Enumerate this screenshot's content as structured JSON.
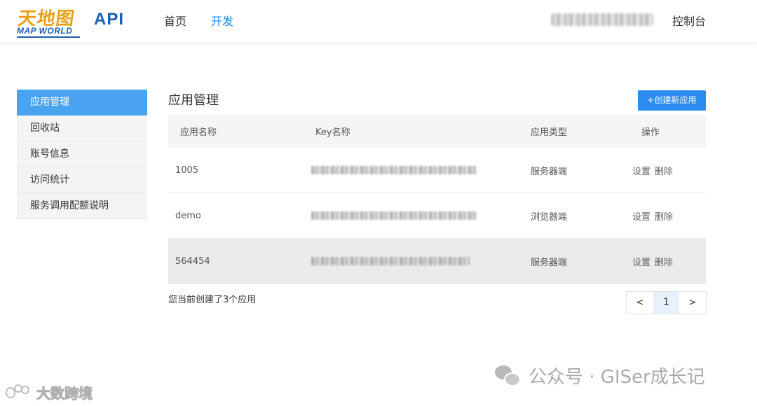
{
  "header": {
    "logo_cn": "天地图",
    "logo_en": "MAP WORLD",
    "api_label": "API",
    "nav": [
      {
        "label": "首页"
      },
      {
        "label": "开发"
      }
    ],
    "console_label": "控制台"
  },
  "sidebar": {
    "items": [
      {
        "label": "应用管理"
      },
      {
        "label": "回收站"
      },
      {
        "label": "账号信息"
      },
      {
        "label": "访问统计"
      },
      {
        "label": "服务调用配额说明"
      }
    ]
  },
  "main": {
    "title": "应用管理",
    "create_button": "+创建新应用",
    "table": {
      "headers": [
        "应用名称",
        "Key名称",
        "应用类型",
        "操作"
      ],
      "rows": [
        {
          "name": "1005",
          "type": "服务器端",
          "actions": [
            "设置",
            "删除"
          ]
        },
        {
          "name": "demo",
          "type": "浏览器端",
          "actions": [
            "设置",
            "删除"
          ]
        },
        {
          "name": "564454",
          "type": "服务器端",
          "actions": [
            "设置",
            "删除"
          ]
        }
      ]
    },
    "count_text": "您当前创建了3个应用",
    "pagination": {
      "prev": "<",
      "current": "1",
      "next": ">"
    }
  },
  "watermarks": {
    "right": "公众号 · GISer成长记",
    "left": "大数跨境"
  },
  "colors": {
    "accent": "#2d8cf0",
    "sidebar_active": "#4aa3f0",
    "nav_active": "#1e88e5"
  }
}
